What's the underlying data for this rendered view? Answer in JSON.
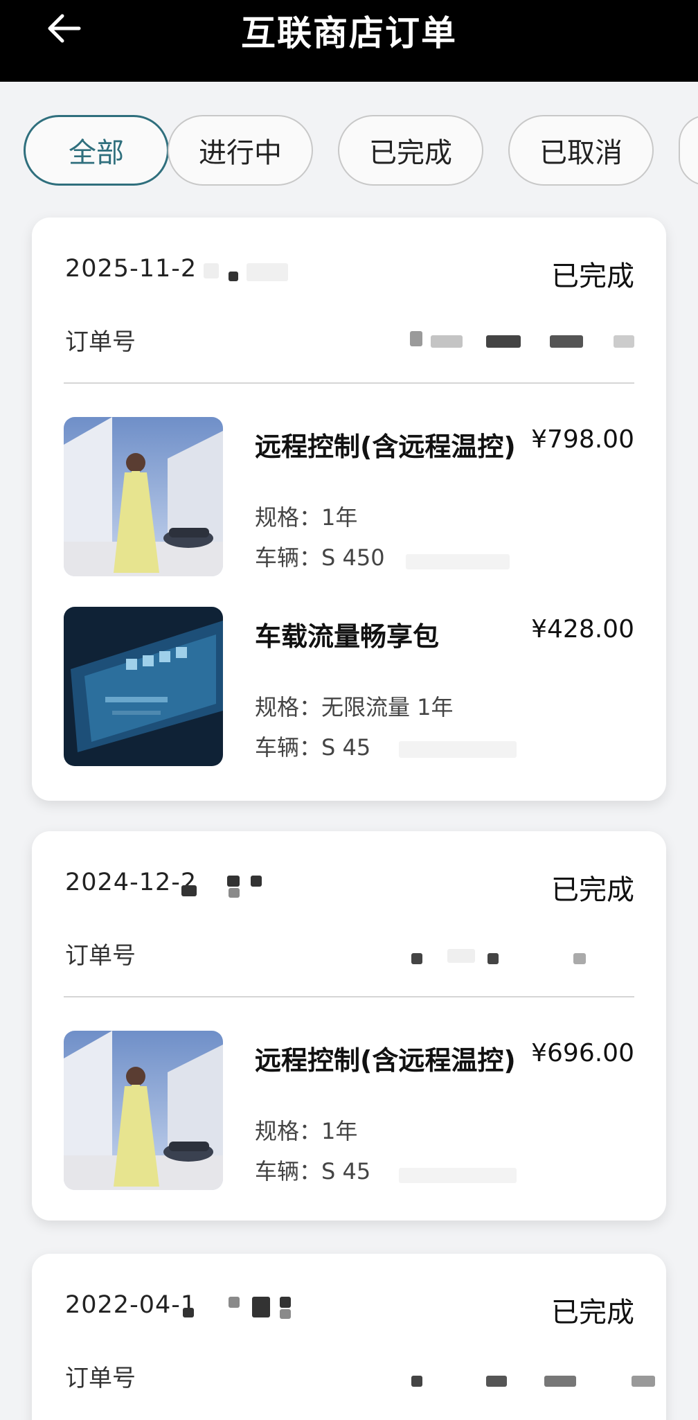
{
  "header": {
    "title": "互联商店订单",
    "back_icon": "arrow-left-icon"
  },
  "tabs": [
    {
      "label": "全部",
      "active": true
    },
    {
      "label": "进行中",
      "active": false
    },
    {
      "label": "已完成",
      "active": false
    },
    {
      "label": "已取消",
      "active": false
    }
  ],
  "orders": [
    {
      "date": "2025-11-2",
      "status": "已完成",
      "order_no_label": "订单号",
      "items": [
        {
          "title": "远程控制(含远程温控)",
          "price": "¥798.00",
          "spec": "规格：1年",
          "vehicle": "车辆：S 450"
        },
        {
          "title": "车载流量畅享包",
          "price": "¥428.00",
          "spec": "规格：无限流量 1年",
          "vehicle": "车辆：S 45"
        }
      ]
    },
    {
      "date": "2024-12-2",
      "status": "已完成",
      "order_no_label": "订单号",
      "items": [
        {
          "title": "远程控制(含远程温控)",
          "price": "¥696.00",
          "spec": "规格：1年",
          "vehicle": "车辆：S 45"
        }
      ]
    },
    {
      "date": "2022-04-1",
      "status": "已完成",
      "order_no_label": "订单号",
      "items": []
    }
  ]
}
